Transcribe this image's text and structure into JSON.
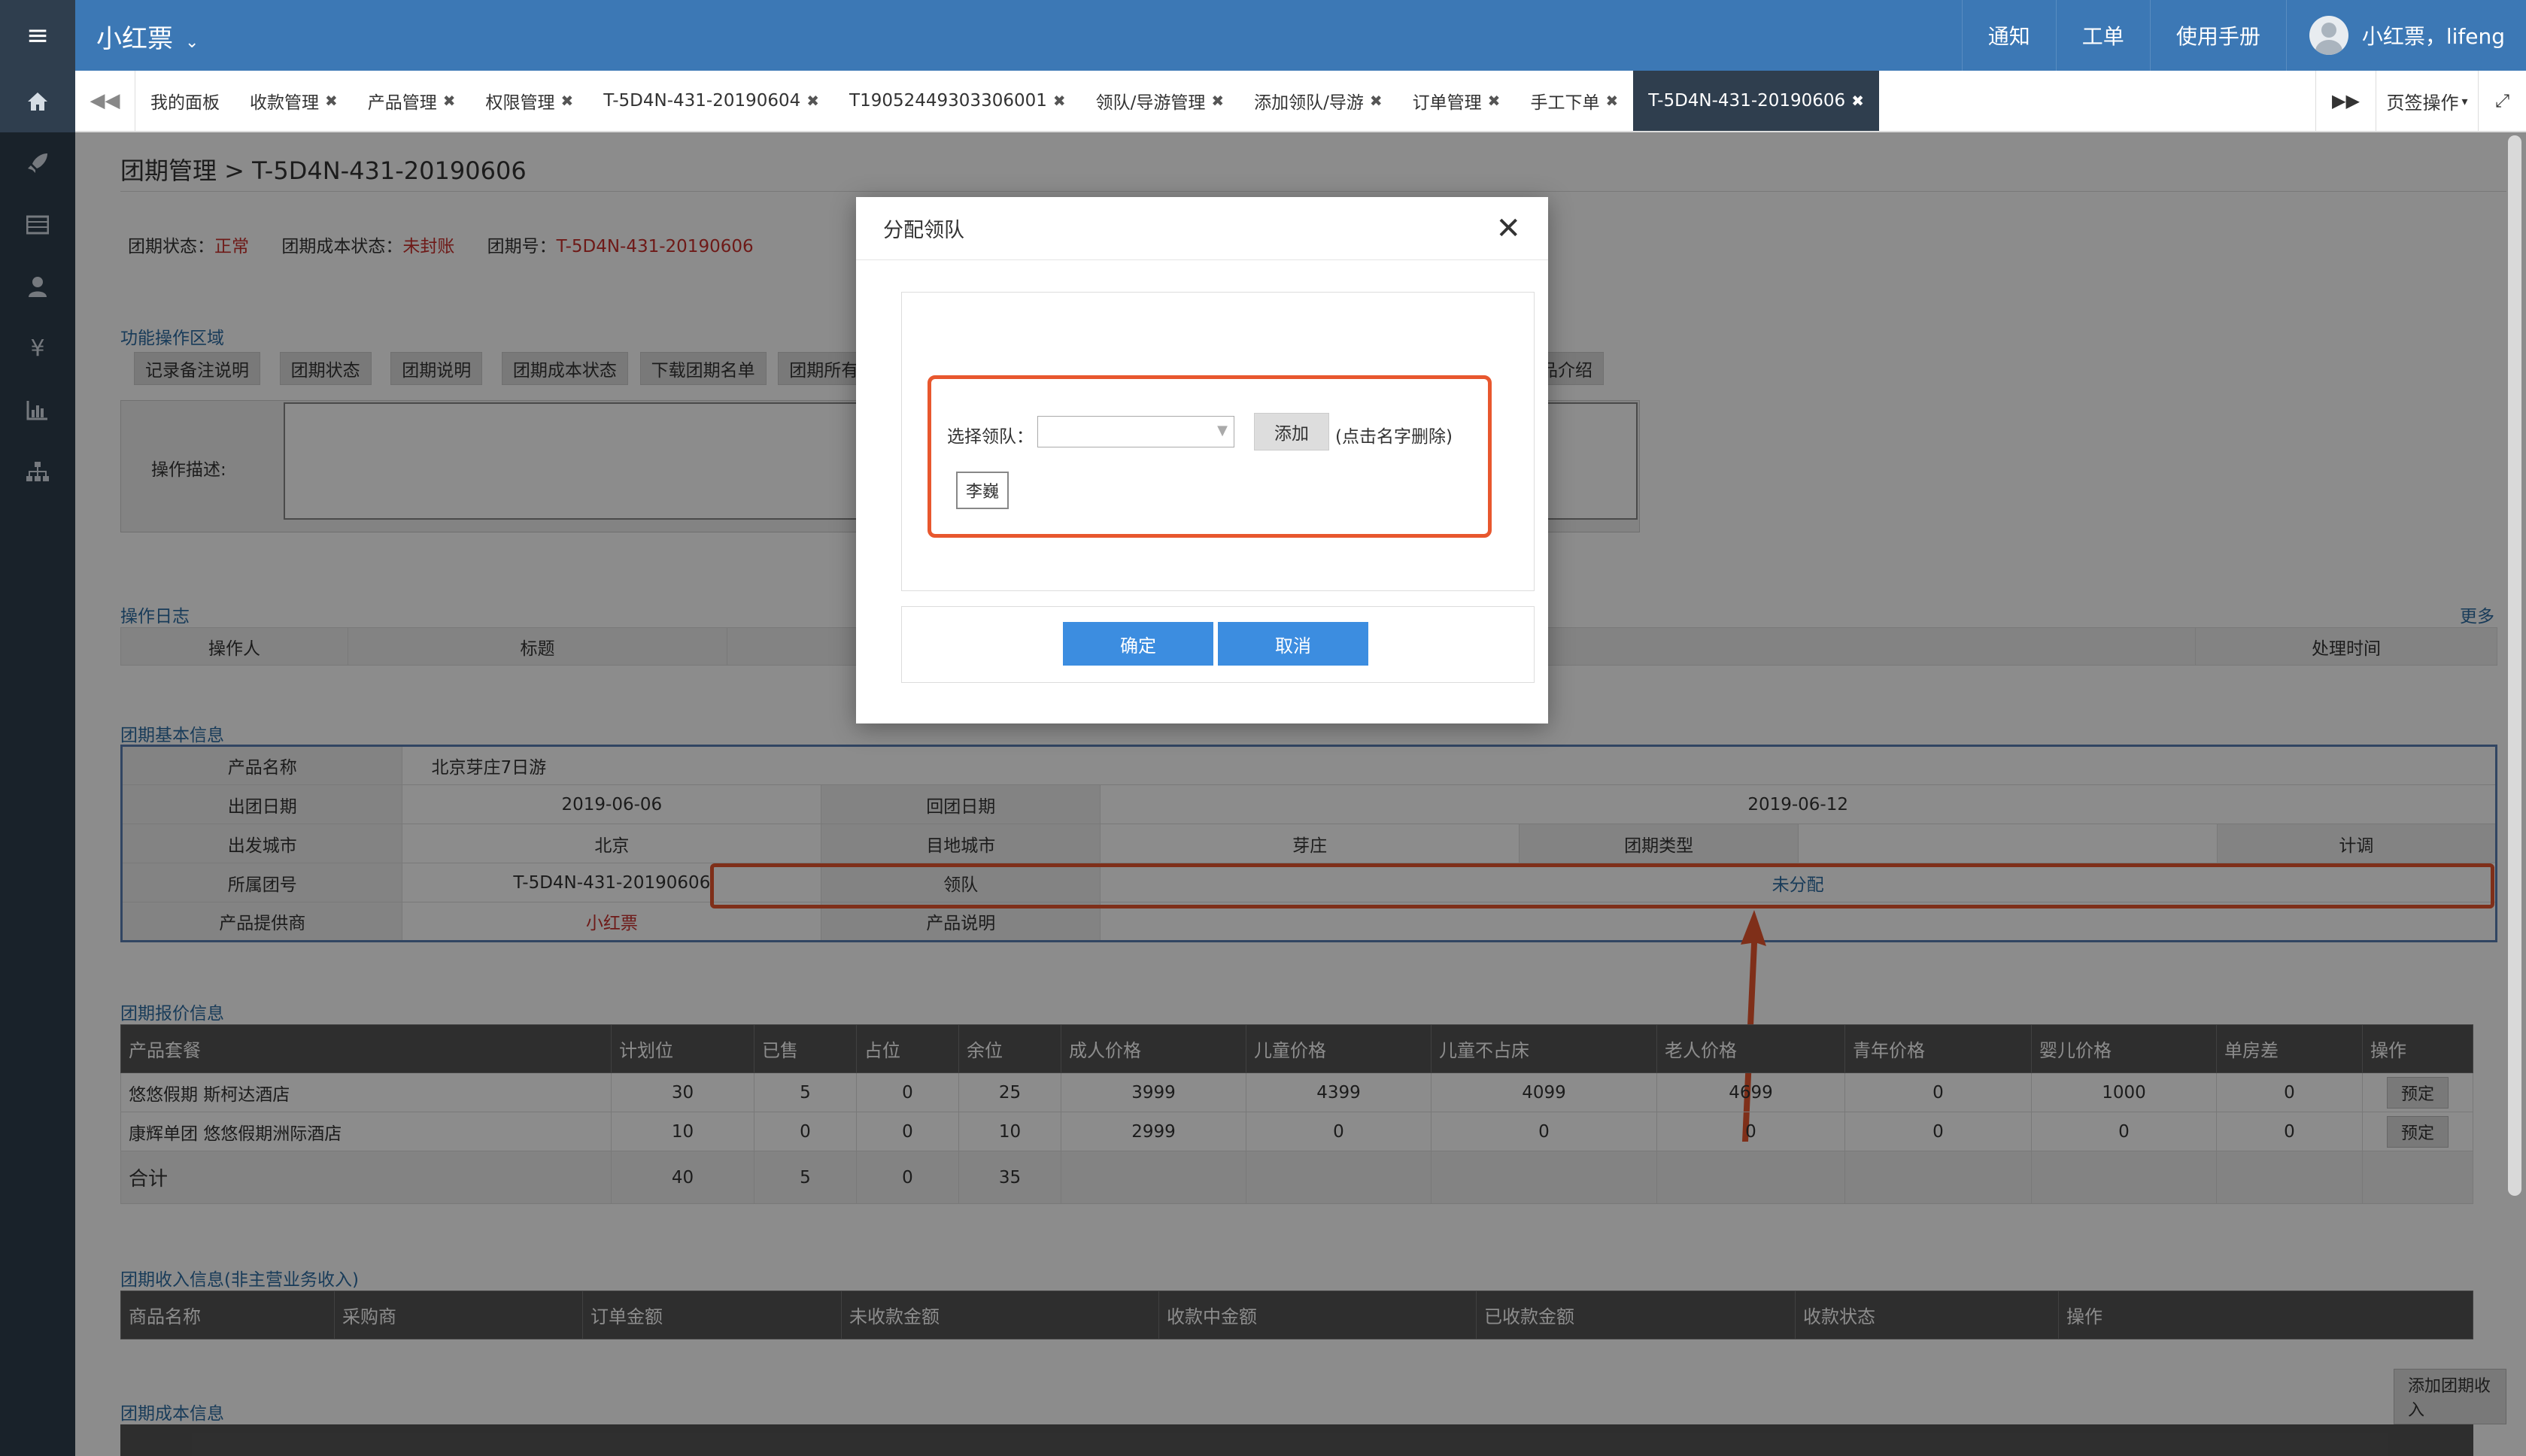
{
  "app": {
    "title": "小红票"
  },
  "topnav": {
    "notice": "通知",
    "ticket": "工单",
    "manual": "使用手册",
    "user": "小红票，lifeng"
  },
  "sidebar_icons": [
    "home-icon",
    "rocket-icon",
    "list-icon",
    "user-icon",
    "yen-icon",
    "bar-chart-icon",
    "sitemap-icon"
  ],
  "tabs": [
    {
      "label": "我的面板",
      "closable": false
    },
    {
      "label": "收款管理",
      "closable": true
    },
    {
      "label": "产品管理",
      "closable": true
    },
    {
      "label": "权限管理",
      "closable": true
    },
    {
      "label": "T-5D4N-431-20190604",
      "closable": true
    },
    {
      "label": "T19052449303306001",
      "closable": true
    },
    {
      "label": "领队/导游管理",
      "closable": true
    },
    {
      "label": "添加领队/导游",
      "closable": true
    },
    {
      "label": "订单管理",
      "closable": true
    },
    {
      "label": "手工下单",
      "closable": true
    },
    {
      "label": "T-5D4N-431-20190606",
      "closable": true,
      "active": true
    }
  ],
  "tab_ops": "页签操作",
  "page": {
    "breadcrumb": "团期管理 >",
    "title": "T-5D4N-431-20190606",
    "status_label": "团期状态：",
    "status_value": "正常",
    "cost_status_label": "团期成本状态：",
    "cost_status_value": "未封账",
    "group_no_label": "团期号：",
    "group_no_value": "T-5D4N-431-20190606"
  },
  "func_area": {
    "title": "功能操作区域",
    "buttons": [
      "记录备注说明",
      "团期状态",
      "团期说明",
      "团期成本状态",
      "下载团期名单",
      "团期所有",
      "产品介绍"
    ],
    "desc_label": "操作描述:"
  },
  "op_log": {
    "title": "操作日志",
    "more": "更多",
    "headers": [
      "操作人",
      "标题",
      "处理时间"
    ]
  },
  "basic_info": {
    "title": "团期基本信息",
    "product_name_label": "产品名称",
    "product_name": "北京芽庄7日游",
    "depart_date_label": "出团日期",
    "depart_date": "2019-06-06",
    "return_date_label": "回团日期",
    "return_date": "2019-06-12",
    "depart_city_label": "出发城市",
    "depart_city": "北京",
    "dest_city_label": "目地城市",
    "dest_city": "芽庄",
    "group_type_label": "团期类型",
    "group_type": "",
    "plan_label": "计调",
    "plan": "",
    "group_no_label": "所属团号",
    "group_no": "T-5D4N-431-20190606",
    "leader_label": "领队",
    "leader": "未分配",
    "supplier_label": "产品提供商",
    "supplier": "小红票",
    "product_desc_label": "产品说明"
  },
  "price_info": {
    "title": "团期报价信息",
    "headers": [
      "产品套餐",
      "计划位",
      "已售",
      "占位",
      "余位",
      "成人价格",
      "儿童价格",
      "儿童不占床",
      "老人价格",
      "青年价格",
      "婴儿价格",
      "单房差",
      "操作"
    ],
    "rows": [
      [
        "悠悠假期 斯柯达酒店",
        "30",
        "5",
        "0",
        "25",
        "3999",
        "4399",
        "4099",
        "4699",
        "0",
        "1000",
        "0",
        "预定"
      ],
      [
        "康辉单团 悠悠假期洲际酒店",
        "10",
        "0",
        "0",
        "10",
        "2999",
        "0",
        "0",
        "0",
        "0",
        "0",
        "0",
        "预定"
      ]
    ],
    "total": [
      "合计",
      "40",
      "5",
      "0",
      "35"
    ]
  },
  "income_info": {
    "title": "团期收入信息(非主营业务收入)",
    "headers": [
      "商品名称",
      "采购商",
      "订单金额",
      "未收款金额",
      "收款中金额",
      "已收款金额",
      "收款状态",
      "操作"
    ],
    "add_button": "添加团期收入"
  },
  "cost_info": {
    "title": "团期成本信息"
  },
  "modal": {
    "title": "分配领队",
    "select_label": "选择领队：",
    "select_value": "",
    "add_button": "添加",
    "hint": "(点击名字删除)",
    "selected_name": "李巍",
    "confirm": "确定",
    "cancel": "取消"
  },
  "colors": {
    "topbar": "#3c78b5",
    "sidebar": "#2f3e4e",
    "highlight": "#e8572e",
    "primary": "#3c8de0"
  }
}
